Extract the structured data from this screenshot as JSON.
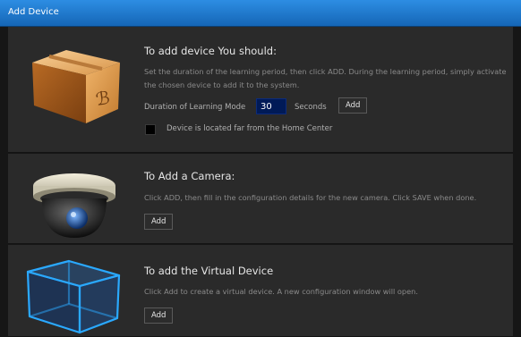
{
  "window": {
    "title": "Add Device"
  },
  "sections": {
    "device": {
      "heading": "To add device You should:",
      "description": "Set the duration of the learning period, then click ADD. During the learning period, simply activate the chosen device to add it to the system.",
      "duration_label": "Duration of Learning Mode",
      "duration_value": "30",
      "units_label": "Seconds",
      "add_label": "Add",
      "far_checkbox_label": "Device is located far from the Home Center",
      "image_icon": "cardboard-box-icon"
    },
    "camera": {
      "heading": "To Add a Camera:",
      "description": "Click ADD, then fill in the configuration details for the new camera. Click SAVE when done.",
      "add_label": "Add",
      "image_icon": "security-camera-icon"
    },
    "virtual": {
      "heading": "To add the Virtual Device",
      "description": "Click Add to create a virtual device. A new configuration window will open.",
      "add_label": "Add",
      "image_icon": "wireframe-cube-icon"
    }
  },
  "colors": {
    "titlebar": "#1e78d0",
    "panel": "#2a2a2a",
    "input_bg": "#001a57"
  }
}
